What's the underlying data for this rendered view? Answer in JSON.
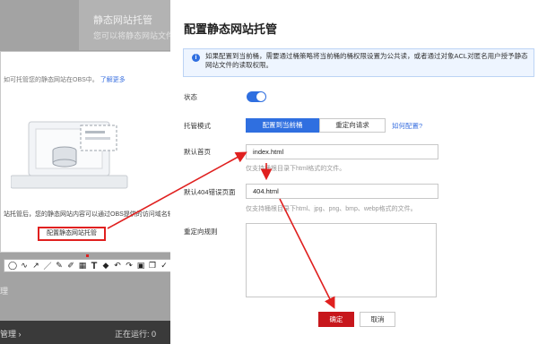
{
  "background": {
    "card_title": "静态网站托管",
    "card_subtitle": "您可以将静态网站文件上",
    "left_text": "理",
    "footer_left": "管理",
    "footer_right": "正在运行: 0"
  },
  "snippet": {
    "hint": "如可托管您的静态网站在OBS中。",
    "hint_link": "了解更多",
    "description": "站托管后，您的静态网站内容可以通过OBS提供的访问域名轻松获取。",
    "button_label": "配置静态网站托管"
  },
  "drawer": {
    "title": "配置静态网站托管",
    "info": "如果配置到当前桶，需要通过桶策略将当前桶的桶权限设置为公共读，或者通过对象ACL对匿名用户授予静态网站文件的读取权限。",
    "status_label": "状态",
    "status_enabled": true,
    "mode_label": "托管模式",
    "mode_options": [
      "配置到当前桶",
      "重定向请求"
    ],
    "mode_help": "如何配置?",
    "index_label": "默认首页",
    "index_value": "index.html",
    "index_hint": "仅支持桶根目录下html格式的文件。",
    "error_label": "默认404错误页面",
    "error_value": "404.html",
    "error_hint": "仅支持桶根目录下html、jpg、png、bmp、webp格式的文件。",
    "redirect_label": "重定向规则",
    "redirect_value": "",
    "confirm_label": "确定",
    "cancel_label": "取消"
  },
  "toolbar_tools": [
    "lasso-icon",
    "freehand-icon",
    "arrow-icon",
    "line-icon",
    "pencil-icon",
    "mosaic-icon",
    "text-icon",
    "eraser-icon",
    "undo-icon",
    "redo-icon",
    "save-icon",
    "copy-icon",
    "confirm-icon"
  ],
  "colors": {
    "primary": "#2f6fe0",
    "confirm": "#c7171c",
    "annotation": "#e0201f"
  }
}
